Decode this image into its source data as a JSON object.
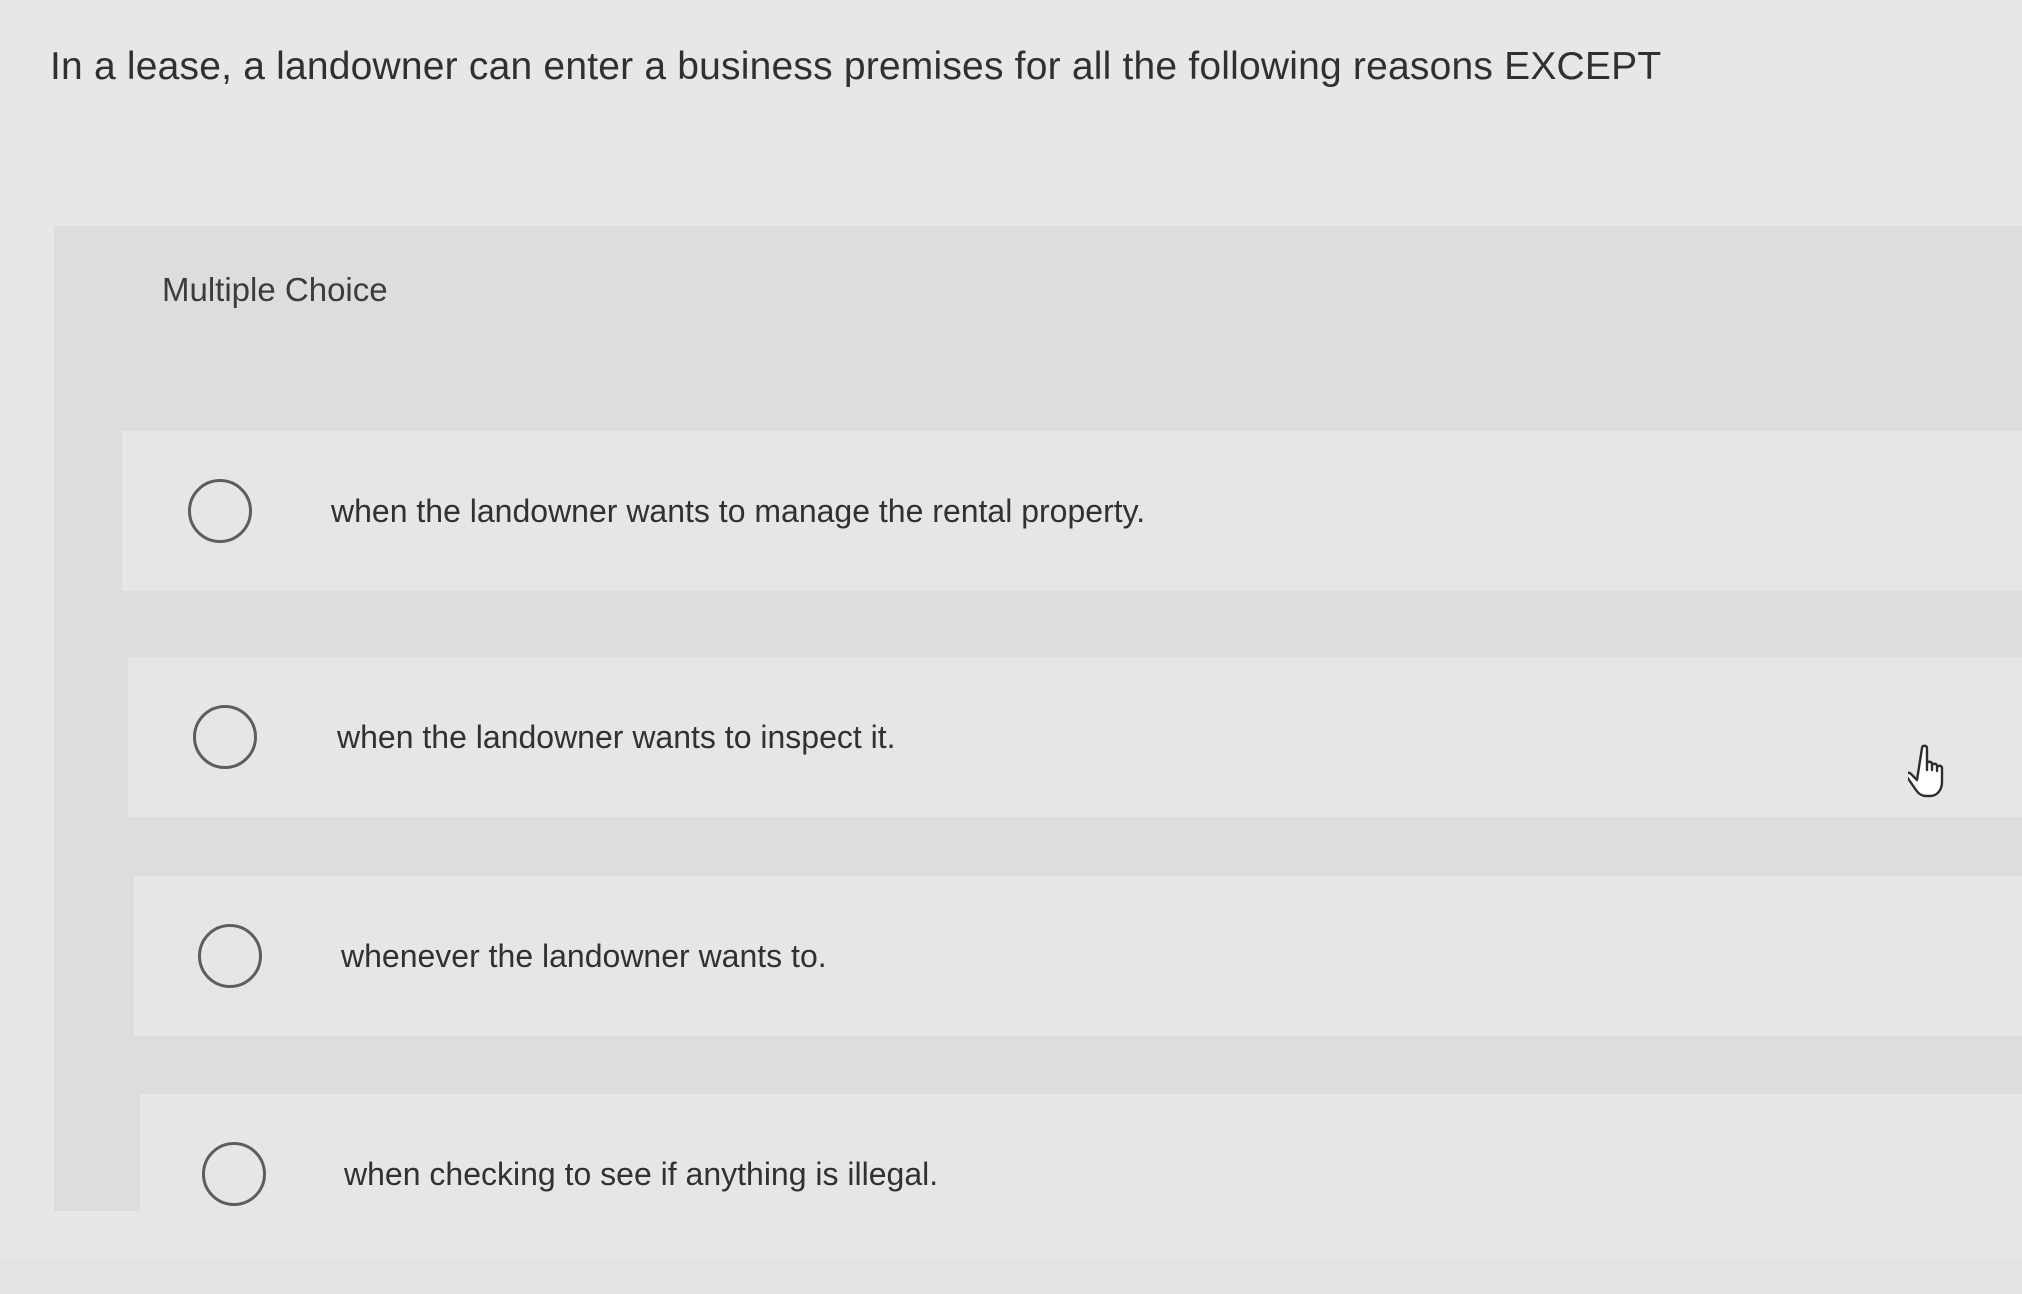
{
  "question": {
    "text": "In a lease, a landowner can enter a business premises for all the following reasons EXCEPT"
  },
  "multiple_choice": {
    "label": "Multiple Choice",
    "options": [
      {
        "text": "when the landowner wants to manage the rental property.",
        "selected": false
      },
      {
        "text": "when the landowner wants to inspect it.",
        "selected": false
      },
      {
        "text": "whenever the landowner wants to.",
        "selected": false
      },
      {
        "text": "when checking to see if anything is illegal.",
        "selected": false
      }
    ]
  },
  "cursor": {
    "icon": "hand-pointer-icon"
  },
  "colors": {
    "background": "#e7e8e6",
    "panel": "#dcdedc",
    "option_row": "#e6e7e5",
    "text": "#2f3133",
    "radio_border": "#5b5e61"
  }
}
